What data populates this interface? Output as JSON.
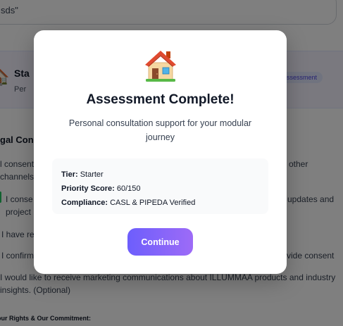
{
  "background": {
    "search_value": "sds\"",
    "card": {
      "title": "Sta",
      "subtitle": "Per",
      "badge": "Assessment"
    },
    "heading": "gal Cons",
    "lines": [
      {
        "left": "l consent",
        "right": "other"
      },
      {
        "left": "channels",
        "right": ""
      },
      {
        "left": "I conse",
        "right": "updates and"
      },
      {
        "left": "project",
        "right": ""
      },
      {
        "left": "I have re",
        "right": ""
      },
      {
        "left": "I confirm",
        "right": "vide consent"
      },
      {
        "left": "I would like to receive marketing communications about ILLUMMAA products and industry",
        "right": ""
      },
      {
        "left": "insights. (Optional)",
        "right": ""
      }
    ],
    "rights_heading": "our Rights & Our Commitment:"
  },
  "modal": {
    "icon": "house-icon",
    "title": "Assessment Complete!",
    "subtitle": "Personal consultation support for your modular journey",
    "info": {
      "tier_label": "Tier:",
      "tier_value": "Starter",
      "score_label": "Priority Score:",
      "score_value": "60/150",
      "compliance_label": "Compliance:",
      "compliance_value": "CASL & PIPEDA Verified"
    },
    "continue_label": "Continue"
  },
  "colors": {
    "button_gradient_start": "#6d5efc",
    "button_gradient_end": "#9d6bf7",
    "overlay": "rgba(0,0,0,0.5)"
  }
}
